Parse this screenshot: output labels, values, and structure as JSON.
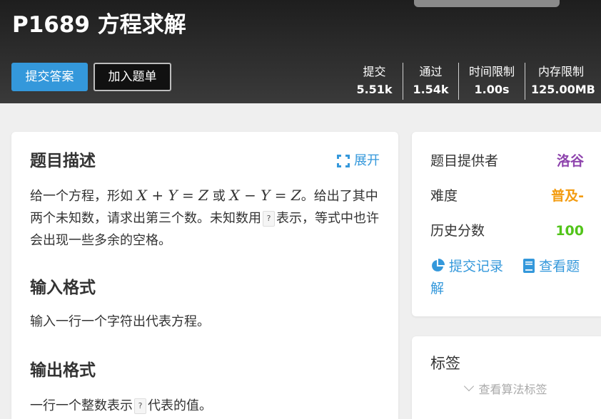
{
  "problem": {
    "title": "P1689 方程求解"
  },
  "actions": {
    "submit_label": "提交答案",
    "add_label": "加入题单"
  },
  "stats": [
    {
      "label": "提交",
      "value": "5.51k"
    },
    {
      "label": "通过",
      "value": "1.54k"
    },
    {
      "label": "时间限制",
      "value": "1.00s"
    },
    {
      "label": "内存限制",
      "value": "125.00MB"
    }
  ],
  "description": {
    "heading": "题目描述",
    "expand_label": "展开",
    "text_1": "给一个方程，形如",
    "math_1": "X + Y = Z",
    "text_2": "或",
    "math_2": "X − Y = Z",
    "text_3": "。给出了其中两个未知数，请求出第三个数。未知数用",
    "qmark": "?",
    "text_4": "表示，等式中也许会出现一些多余的空格。"
  },
  "input_format": {
    "heading": "输入格式",
    "text": "输入一行一个字符出代表方程。"
  },
  "output_format": {
    "heading": "输出格式",
    "text_1": "一行一个整数表示",
    "qmark": "?",
    "text_2": "代表的值。"
  },
  "sidebar": {
    "provider_label": "题目提供者",
    "provider_value": "洛谷",
    "difficulty_label": "难度",
    "difficulty_value": "普及-",
    "history_label": "历史分数",
    "history_value": "100",
    "records_link": "提交记录",
    "solutions_link": "查看题解"
  },
  "tags": {
    "title": "标签",
    "show_label": "查看算法标签"
  },
  "colors": {
    "accent": "#3498db",
    "provider": "#8e44ad",
    "difficulty": "#f39c11",
    "score": "#52c41a"
  },
  "icons": {
    "expand": "expand-icon",
    "records": "pie-chart-icon",
    "solutions": "book-icon",
    "tags_toggle": "chevron-down-icon"
  }
}
